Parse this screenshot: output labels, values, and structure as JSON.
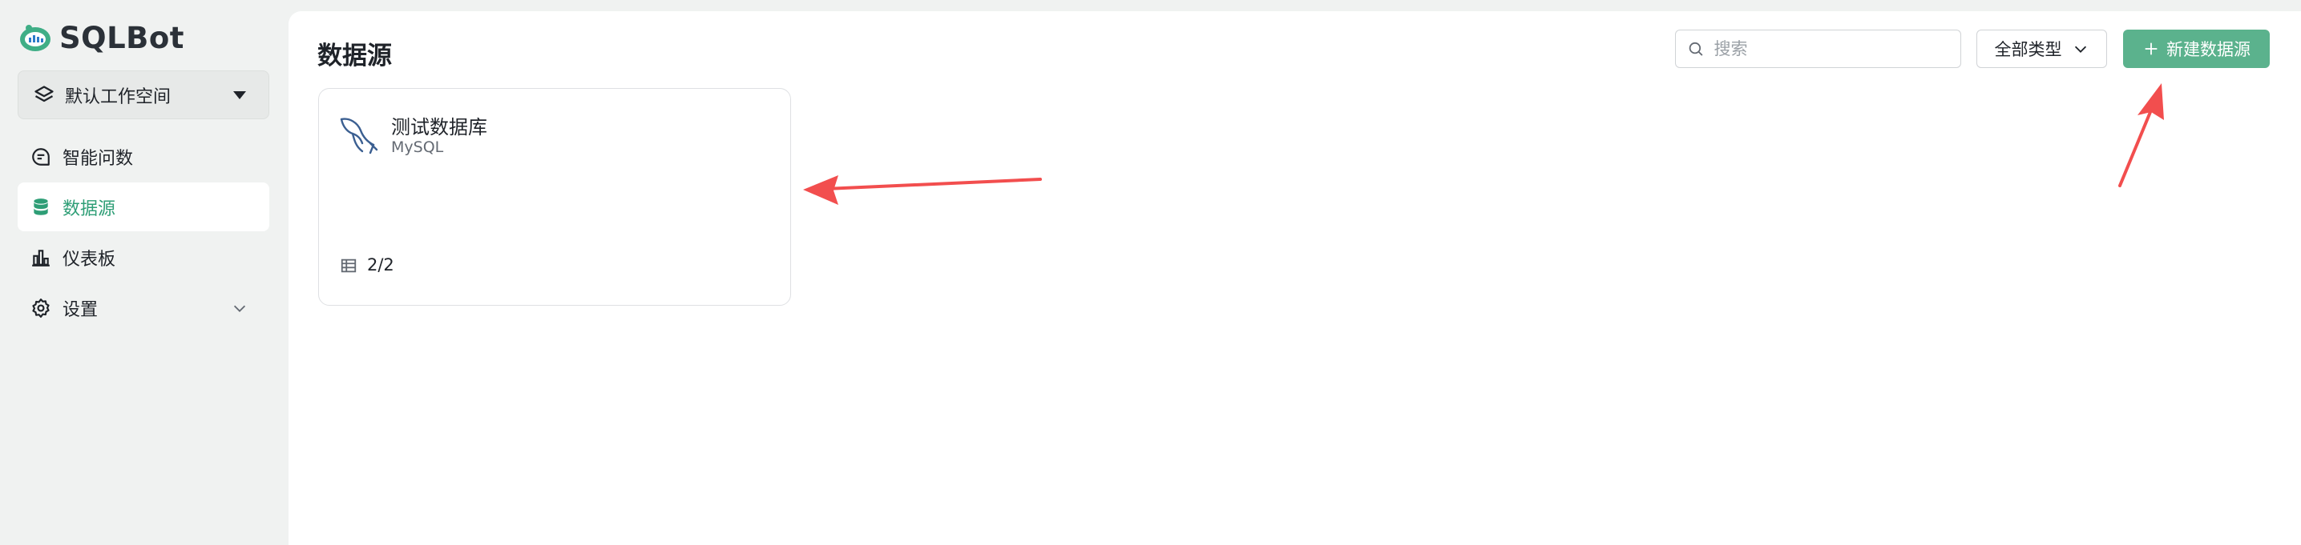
{
  "app": {
    "name": "SQLBot"
  },
  "sidebar": {
    "workspace": {
      "label": "默认工作空间"
    },
    "items": [
      {
        "label": "智能问数",
        "icon": "chat-icon",
        "active": false
      },
      {
        "label": "数据源",
        "icon": "database-icon",
        "active": true
      },
      {
        "label": "仪表板",
        "icon": "dashboard-icon",
        "active": false
      },
      {
        "label": "设置",
        "icon": "gear-icon",
        "active": false,
        "expandable": true
      }
    ]
  },
  "main": {
    "title": "数据源",
    "search": {
      "placeholder": "搜索",
      "value": ""
    },
    "type_filter": {
      "selected": "全部类型"
    },
    "new_button": {
      "label": "新建数据源"
    },
    "cards": [
      {
        "name": "测试数据库",
        "type": "MySQL",
        "tables": "2/2",
        "icon": "mysql-dolphin-icon"
      }
    ]
  },
  "colors": {
    "accent": "#5bb28d",
    "active_text": "#2e9e76",
    "annotation": "#f24e4e"
  }
}
